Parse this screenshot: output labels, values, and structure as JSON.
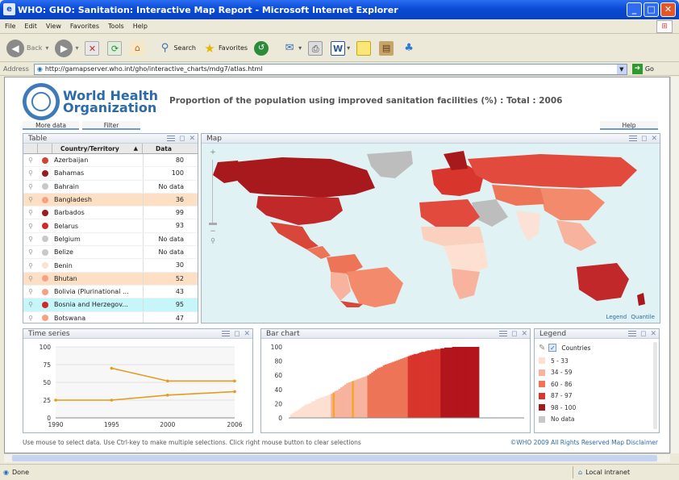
{
  "window": {
    "title": "WHO: GHO: Sanitation: Interactive Map Report - Microsoft Internet Explorer",
    "minimize": "_",
    "maximize": "□",
    "close": "✕"
  },
  "menu": [
    "File",
    "Edit",
    "View",
    "Favorites",
    "Tools",
    "Help"
  ],
  "toolbar": {
    "back": "Back",
    "search": "Search",
    "favorites": "Favorites"
  },
  "address": {
    "label": "Address",
    "url": "http://gamapserver.who.int/gho/interactive_charts/mdg7/atlas.html",
    "go": "Go"
  },
  "page": {
    "org_line1": "World Health",
    "org_line2": "Organization",
    "title": "Proportion of the population using improved sanitation facilities (%) : Total :  2006",
    "more_data": "More data",
    "filter": "Filter",
    "help": "Help"
  },
  "table": {
    "title": "Table",
    "col_country": "Country/Territory",
    "col_data": "Data",
    "sort_icon": "▲",
    "rows": [
      {
        "country": "Azerbaijan",
        "value": "80",
        "color": "#cf4236",
        "state": ""
      },
      {
        "country": "Bahamas",
        "value": "100",
        "color": "#9b1c20",
        "state": ""
      },
      {
        "country": "Bahrain",
        "value": "No data",
        "color": "#c8c8c8",
        "state": ""
      },
      {
        "country": "Bangladesh",
        "value": "36",
        "color": "#f6a086",
        "state": "sel"
      },
      {
        "country": "Barbados",
        "value": "99",
        "color": "#9b1c20",
        "state": ""
      },
      {
        "country": "Belarus",
        "value": "93",
        "color": "#cf2a2a",
        "state": ""
      },
      {
        "country": "Belgium",
        "value": "No data",
        "color": "#c8c8c8",
        "state": ""
      },
      {
        "country": "Belize",
        "value": "No data",
        "color": "#c8c8c8",
        "state": ""
      },
      {
        "country": "Benin",
        "value": "30",
        "color": "#fce2d6",
        "state": ""
      },
      {
        "country": "Bhutan",
        "value": "52",
        "color": "#f6a086",
        "state": "sel"
      },
      {
        "country": "Bolivia (Plurinational ...",
        "value": "43",
        "color": "#f6a086",
        "state": ""
      },
      {
        "country": "Bosnia and Herzegov...",
        "value": "95",
        "color": "#cf2a2a",
        "state": "sel2"
      },
      {
        "country": "Botswana",
        "value": "47",
        "color": "#f6a086",
        "state": ""
      }
    ]
  },
  "map": {
    "title": "Map",
    "legend_link": "Legend",
    "quantile_link": "Quantile"
  },
  "timeseries": {
    "title": "Time series",
    "y_ticks": [
      "100",
      "75",
      "50",
      "25",
      "0"
    ],
    "x_ticks": [
      "1990",
      "1995",
      "2000",
      "2006"
    ]
  },
  "barchart": {
    "title": "Bar chart",
    "y_ticks": [
      "100",
      "80",
      "60",
      "40",
      "20",
      "0"
    ]
  },
  "legend": {
    "title": "Legend",
    "countries_label": "Countries",
    "items": [
      {
        "label": "5 - 33",
        "color": "#fde0d2"
      },
      {
        "label": "34 - 59",
        "color": "#f7b39d"
      },
      {
        "label": "60 - 86",
        "color": "#ee7458"
      },
      {
        "label": "87 - 97",
        "color": "#d8352d"
      },
      {
        "label": "98 - 100",
        "color": "#9b1c20"
      },
      {
        "label": "No data",
        "color": "#c8c8c8"
      }
    ]
  },
  "footer": {
    "hint": "Use mouse to select data.  Use Ctrl-key to make multiple selections.  Click right mouse button to clear selections",
    "copyright": "©WHO 2009  All Rights Reserved  Map Disclaimer"
  },
  "status": {
    "done": "Done",
    "zone": "Local intranet"
  },
  "chart_data": [
    {
      "type": "line",
      "title": "Time series",
      "x": [
        1990,
        1995,
        2000,
        2006
      ],
      "series": [
        {
          "values": [
            null,
            70,
            52,
            52
          ]
        },
        {
          "values": [
            25,
            25,
            32,
            37
          ]
        }
      ],
      "ylim": [
        0,
        100
      ],
      "color": "#e59b1b"
    },
    {
      "type": "bar",
      "title": "Bar chart",
      "ylim": [
        0,
        100
      ],
      "classes": [
        {
          "color": "#fde0d2",
          "values": [
            5,
            7,
            9,
            10,
            12,
            14,
            16,
            18,
            19,
            20,
            21,
            23,
            24,
            26,
            27,
            28,
            29,
            30,
            31,
            32,
            33
          ]
        },
        {
          "color": "#f7b39d",
          "values": [
            34,
            36,
            38,
            39,
            41,
            43,
            45,
            47,
            49,
            50,
            51,
            52,
            53,
            54,
            55,
            56,
            57,
            58,
            59
          ]
        },
        {
          "color": "#ee7458",
          "values": [
            60,
            62,
            64,
            66,
            68,
            70,
            71,
            72,
            74,
            75,
            76,
            77,
            78,
            79,
            80,
            81,
            82,
            83,
            84,
            85,
            86
          ]
        },
        {
          "color": "#d8352d",
          "values": [
            87,
            88,
            89,
            90,
            90,
            91,
            92,
            93,
            93,
            94,
            95,
            95,
            96,
            96,
            97,
            97,
            97
          ]
        },
        {
          "color": "#b3151c",
          "values": [
            98,
            98,
            99,
            99,
            99,
            99,
            100,
            100,
            100,
            100,
            100,
            100,
            100,
            100,
            100,
            100,
            100,
            100,
            100,
            100
          ]
        }
      ],
      "highlighted": [
        {
          "class": 1,
          "index": 1,
          "color": "#f5a623"
        },
        {
          "class": 1,
          "index": 11,
          "color": "#f5a623"
        }
      ]
    }
  ]
}
